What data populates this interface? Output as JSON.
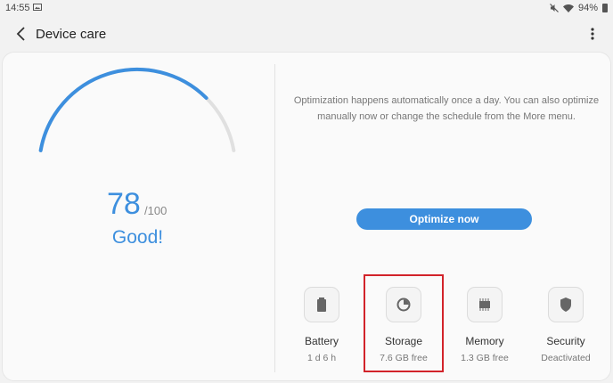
{
  "status_bar": {
    "time": "14:55",
    "battery": "94%",
    "icons": [
      "image-icon",
      "mute-icon",
      "wifi-icon",
      "battery-icon"
    ]
  },
  "app_bar": {
    "title": "Device care",
    "back_icon": "back-arrow-icon",
    "menu_icon": "more-vert-icon"
  },
  "score": {
    "value": "78",
    "max": "/100",
    "status": "Good!",
    "fraction": 0.78
  },
  "description": "Optimization happens automatically once a day. You can also optimize manually now or change the schedule from the More menu.",
  "optimize_button": "Optimize now",
  "tiles": [
    {
      "label": "Battery",
      "value": "1 d 6 h",
      "icon": "battery-icon"
    },
    {
      "label": "Storage",
      "value": "7.6 GB free",
      "icon": "pie-chart-icon",
      "highlighted": true
    },
    {
      "label": "Memory",
      "value": "1.3 GB free",
      "icon": "memory-chip-icon"
    },
    {
      "label": "Security",
      "value": "Deactivated",
      "icon": "shield-icon"
    }
  ],
  "colors": {
    "accent": "#3d8fde",
    "highlight": "#d2232a",
    "gauge_track": "#e0e0e0"
  }
}
